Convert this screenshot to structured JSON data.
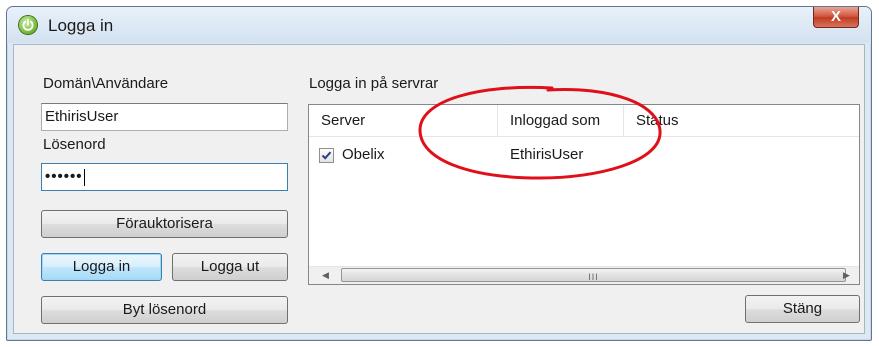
{
  "window": {
    "title": "Logga in",
    "close_label": "X"
  },
  "left_panel": {
    "domain_user_label": "Domän\\Användare",
    "domain_user_value": "EthirisUser",
    "password_label": "Lösenord",
    "password_value": "••••••",
    "preauthorize_button": "Förauktorisera",
    "login_button": "Logga in",
    "logout_button": "Logga ut",
    "change_password_button": "Byt lösenord"
  },
  "server_panel": {
    "group_label": "Logga in på servrar",
    "columns": [
      "Server",
      "Inloggad som",
      "Status"
    ],
    "rows": [
      {
        "checked": true,
        "server": "Obelix",
        "logged_in_as": "EthirisUser",
        "status": ""
      }
    ],
    "scroll_grip": "III"
  },
  "close_button": "Stäng",
  "colors": {
    "annotation": "#e0101a",
    "selection_focus": "#3c7fb1",
    "window_frame": "#dde8f3"
  }
}
